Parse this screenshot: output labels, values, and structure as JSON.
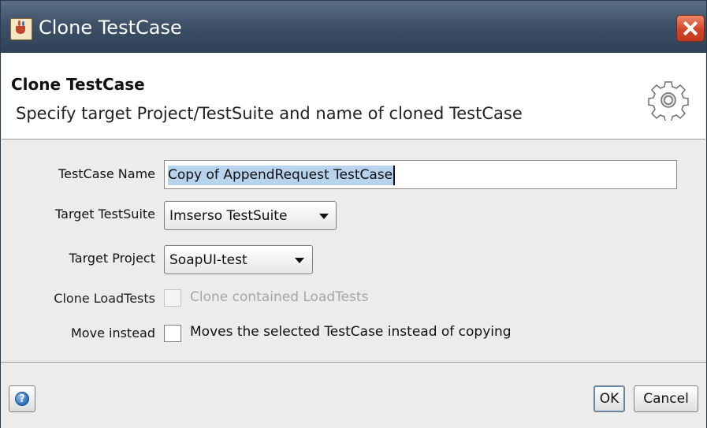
{
  "window": {
    "title": "Clone TestCase",
    "icon": "java-app-icon"
  },
  "header": {
    "title": "Clone TestCase",
    "description": "Specify target Project/TestSuite and name of cloned TestCase",
    "icon": "gear-icon"
  },
  "form": {
    "testcase_name": {
      "label": "TestCase Name",
      "value": "Copy of AppendRequest TestCase"
    },
    "target_testsuite": {
      "label": "Target TestSuite",
      "value": "Imserso TestSuite"
    },
    "target_project": {
      "label": "Target Project",
      "value": "SoapUI-test"
    },
    "clone_loadtests": {
      "label": "Clone LoadTests",
      "checkbox_label": "Clone contained LoadTests",
      "checked": false,
      "enabled": false
    },
    "move_instead": {
      "label": "Move instead",
      "checkbox_label": "Moves the selected TestCase instead of copying",
      "checked": false,
      "enabled": true
    }
  },
  "footer": {
    "help_icon": "help-icon",
    "ok_label": "OK",
    "cancel_label": "Cancel"
  },
  "colors": {
    "titlebar": "#3e5168",
    "close_button": "#d3442a",
    "selection": "#b8d3ec"
  }
}
